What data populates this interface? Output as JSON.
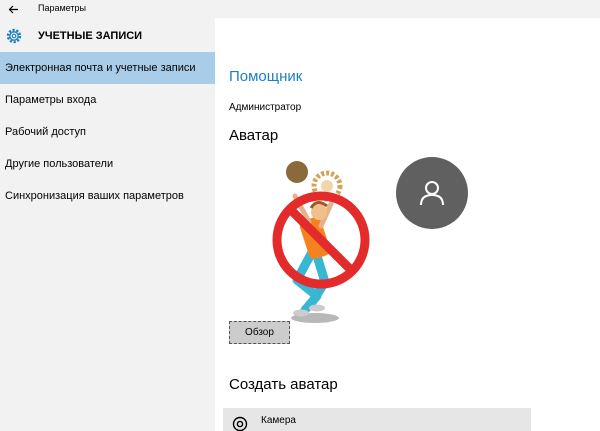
{
  "window": {
    "title": "Параметры"
  },
  "header": {
    "title": "УЧЕТНЫЕ ЗАПИСИ"
  },
  "sidebar": {
    "items": [
      {
        "label": "Электронная почта и учетные записи",
        "selected": true
      },
      {
        "label": "Параметры входа"
      },
      {
        "label": "Рабочий доступ"
      },
      {
        "label": "Другие пользователи"
      },
      {
        "label": "Синхронизация ваших параметров"
      }
    ]
  },
  "main": {
    "account_name": "Помощник",
    "account_role": "Администратор",
    "avatar_heading": "Аватар",
    "browse_label": "Обзор",
    "create_heading": "Создать аватар",
    "camera_label": "Камера"
  },
  "colors": {
    "accent": "#1a7fc3",
    "sidebar_bg": "#f2f2f2",
    "selected_bg": "#a9cde8",
    "avatar_circle": "#606060"
  },
  "icons": {
    "back": "arrow-left-icon",
    "settings": "gear-icon",
    "user": "user-icon",
    "camera": "camera-icon"
  }
}
